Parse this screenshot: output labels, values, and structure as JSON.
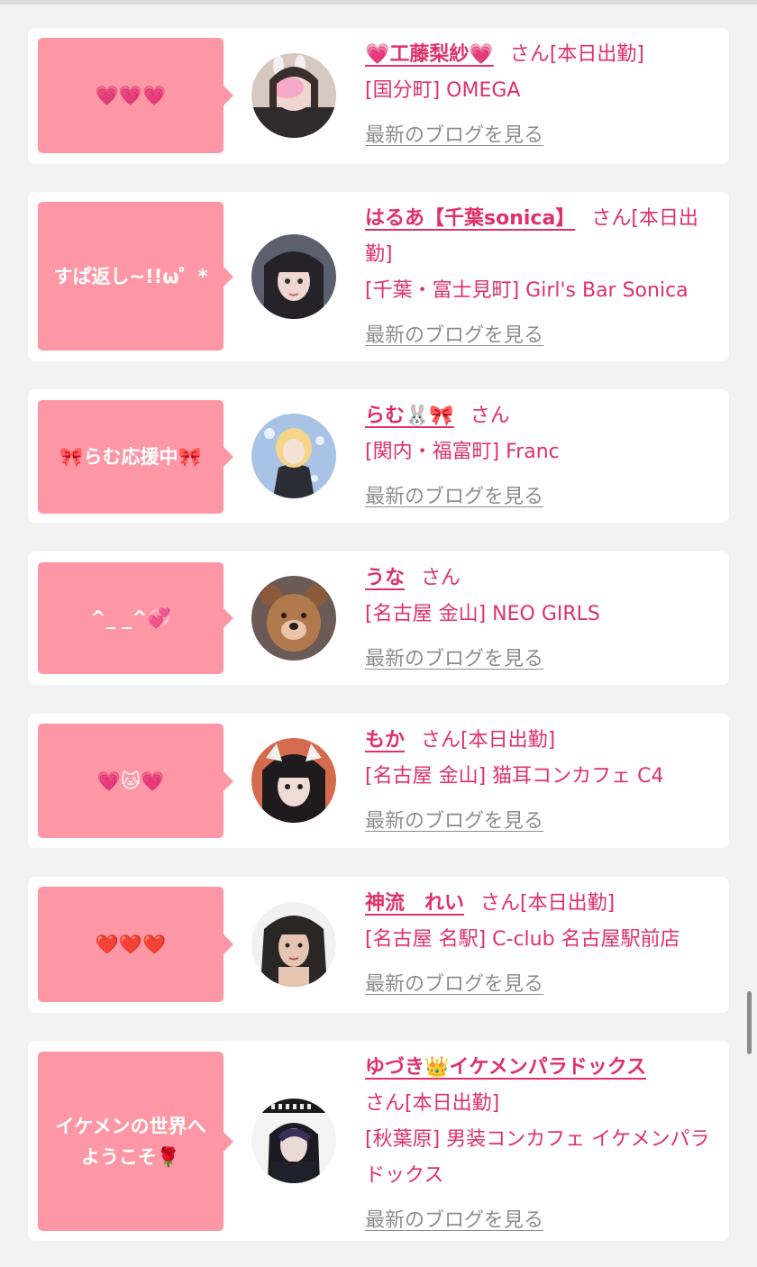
{
  "blog_link_label": "最新のブログを見る",
  "san_label": "さん",
  "colors": {
    "background": "#f2f2f2",
    "bubble": "#fd97a5",
    "accent": "#e0306a",
    "link": "#8e8e8e"
  },
  "cards": [
    {
      "bubble": "💗💗💗",
      "name": "💗工藤梨紗💗",
      "status": "[本日出勤]",
      "shop": "[国分町] OMEGA"
    },
    {
      "bubble": "すぱ返し~!!ω゜*",
      "name": "はるあ【千葉sonica】",
      "status": "[本日出勤]",
      "shop": "[千葉・富士見町] Girl's Bar Sonica"
    },
    {
      "bubble": "🎀らむ応援中🎀",
      "name": "らむ🐰🎀",
      "status": "",
      "shop": "[関内・福富町] Franc"
    },
    {
      "bubble": "^_ _^💞",
      "name": "うな",
      "status": "",
      "shop": "[名古屋 金山] NEO GIRLS"
    },
    {
      "bubble": "💗🐱💗",
      "name": "もか",
      "status": "[本日出勤]",
      "shop": "[名古屋 金山] 猫耳コンカフェ C4"
    },
    {
      "bubble": "❤️❤️❤️",
      "name": "神流　れい",
      "status": "[本日出勤]",
      "shop": "[名古屋 名駅] C-club 名古屋駅前店"
    },
    {
      "bubble": "イケメンの世界へ\nようこそ🌹",
      "name": "ゆづき👑イケメンパラドックス",
      "status": "[本日出勤]",
      "shop": "[秋葉原] 男装コンカフェ イケメンパラドックス"
    }
  ]
}
